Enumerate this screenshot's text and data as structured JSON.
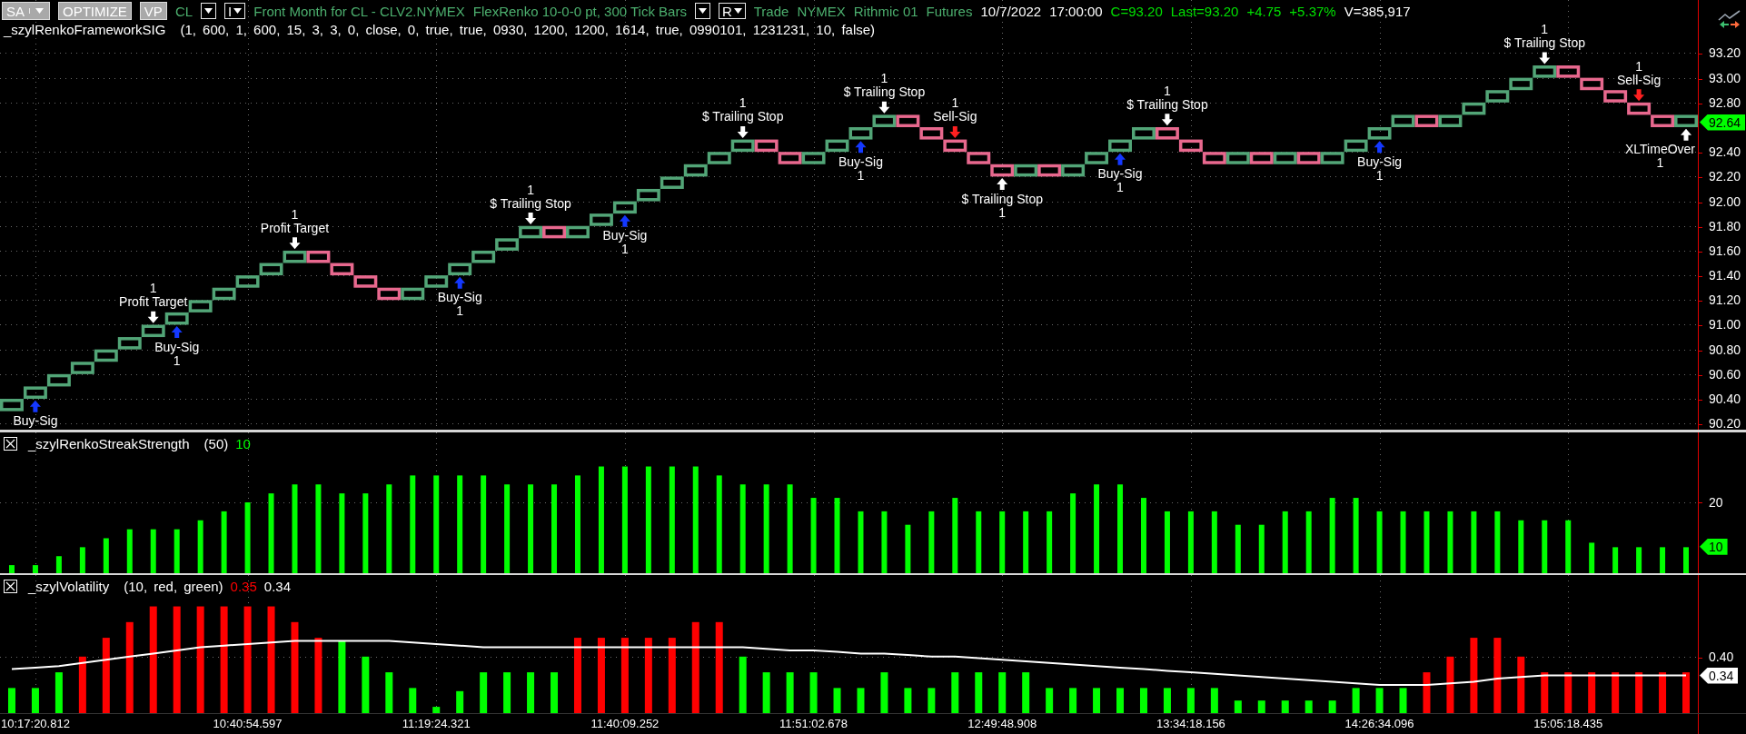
{
  "header": [
    {
      "kind": "button",
      "label": "SA",
      "dropdown": true
    },
    {
      "kind": "button",
      "label": "OPTIMIZE",
      "dropdown": false
    },
    {
      "kind": "button",
      "label": "VP",
      "dropdown": false
    },
    {
      "kind": "text",
      "text": "CL",
      "color": "#4caf6e"
    },
    {
      "kind": "dropdown"
    },
    {
      "kind": "dropdown",
      "label": "I"
    },
    {
      "kind": "text",
      "text": "Front Month for CL - CLV2.NYMEX",
      "color": "#4caf6e"
    },
    {
      "kind": "text",
      "text": "FlexRenko 10-0-0 pt, 300 Tick Bars",
      "color": "#4caf6e"
    },
    {
      "kind": "dropdown"
    },
    {
      "kind": "dropdown",
      "label": "R"
    },
    {
      "kind": "text",
      "text": "Trade",
      "color": "#4caf6e"
    },
    {
      "kind": "text",
      "text": "NYMEX",
      "color": "#4caf6e"
    },
    {
      "kind": "text",
      "text": "Rithmic 01",
      "color": "#4caf6e"
    },
    {
      "kind": "text",
      "text": "Futures",
      "color": "#4caf6e"
    },
    {
      "kind": "text",
      "text": "10/7/2022",
      "color": "#ffffff"
    },
    {
      "kind": "text",
      "text": "17:00:00",
      "color": "#ffffff"
    },
    {
      "kind": "text",
      "text": "C=93.20",
      "color": "#00e000"
    },
    {
      "kind": "text",
      "text": "Last=93.20",
      "color": "#00e000"
    },
    {
      "kind": "text",
      "text": "+4.75",
      "color": "#00e000"
    },
    {
      "kind": "text",
      "text": "+5.37%",
      "color": "#00e000"
    },
    {
      "kind": "text",
      "text": "V=385,917",
      "color": "#ffffff"
    }
  ],
  "panels": [
    {
      "kind": "price",
      "title": "_szylRenkoFrameworkSIG",
      "params": "(1, 600, 1, 600, 15, 3, 3, 0, close, 0, true, true, 0930, 1200, 1200, 1614, true, 0990101, 1231231, 10, false)",
      "marker": {
        "text": "92.64",
        "color": "#00ff00"
      },
      "chart_data": {
        "type": "scatter",
        "categories": [
          null,
          null,
          null,
          null,
          null,
          null,
          null,
          null,
          null,
          null,
          null,
          null,
          null,
          null,
          null,
          null,
          null,
          null,
          null,
          null,
          null,
          null,
          null,
          null,
          null,
          null,
          null,
          null,
          null,
          null,
          null,
          null,
          null,
          null,
          null,
          null,
          null,
          null,
          null,
          null,
          null,
          null,
          null,
          null,
          null,
          null,
          null,
          null,
          null,
          null,
          null,
          null,
          null,
          null,
          null,
          null,
          null,
          null,
          null,
          null,
          null,
          null,
          null,
          null,
          null,
          null,
          null,
          null,
          null,
          null,
          null,
          null
        ],
        "grid": true,
        "ylim": [
          90.15,
          93.63
        ],
        "yticks": [
          {
            "value": 93.2,
            "label": "93.20"
          },
          {
            "value": 93.0,
            "label": "93.00"
          },
          {
            "value": 92.8,
            "label": "92.80"
          },
          {
            "value": 92.4,
            "label": "92.40"
          },
          {
            "value": 92.2,
            "label": "92.20"
          },
          {
            "value": 92.0,
            "label": "92.00"
          },
          {
            "value": 91.8,
            "label": "91.80"
          },
          {
            "value": 91.6,
            "label": "91.60"
          },
          {
            "value": 91.4,
            "label": "91.40"
          },
          {
            "value": 91.2,
            "label": "91.20"
          },
          {
            "value": 91.0,
            "label": "91.00"
          },
          {
            "value": 90.8,
            "label": "90.80"
          },
          {
            "value": 90.6,
            "label": "90.60"
          },
          {
            "value": 90.4,
            "label": "90.40"
          },
          {
            "value": 90.2,
            "label": "90.20"
          }
        ],
        "series": [
          {
            "color": "#52a577",
            "values": [
              90.35,
              90.45,
              90.55,
              90.65,
              90.75,
              90.85,
              90.95,
              91.05,
              91.15,
              91.25,
              91.35,
              91.45,
              91.55,
              null,
              null,
              null,
              null,
              91.25,
              91.35,
              91.45,
              91.55,
              91.65,
              91.75,
              null,
              91.75,
              91.85,
              91.95,
              92.05,
              92.15,
              92.25,
              92.35,
              92.45,
              null,
              null,
              92.35,
              92.45,
              92.55,
              92.65,
              null,
              null,
              null,
              null,
              null,
              92.25,
              null,
              92.25,
              92.35,
              92.45,
              92.55,
              null,
              null,
              null,
              92.35,
              null,
              92.35,
              null,
              92.35,
              92.45,
              92.55,
              92.65,
              null,
              92.65,
              92.75,
              92.85,
              92.95,
              93.05,
              null,
              null,
              null,
              null,
              null,
              92.65
            ]
          },
          {
            "color": "#e8688e",
            "values": [
              null,
              null,
              null,
              null,
              null,
              null,
              null,
              null,
              null,
              null,
              null,
              null,
              null,
              91.55,
              91.45,
              91.35,
              91.25,
              null,
              null,
              null,
              null,
              null,
              null,
              91.75,
              null,
              null,
              null,
              null,
              null,
              null,
              null,
              null,
              92.45,
              92.35,
              null,
              null,
              null,
              null,
              92.65,
              92.55,
              92.45,
              92.35,
              92.25,
              null,
              92.25,
              null,
              null,
              null,
              null,
              92.55,
              92.45,
              92.35,
              null,
              92.35,
              null,
              92.35,
              null,
              null,
              null,
              null,
              92.65,
              null,
              null,
              null,
              null,
              null,
              93.05,
              92.95,
              92.85,
              92.75,
              92.65,
              null
            ]
          },
          {
            "color": "#1438ff",
            "type": "scatter",
            "values": [
              null,
              90.34,
              null,
              null,
              null,
              null,
              null,
              90.94,
              null,
              null,
              null,
              null,
              null,
              null,
              null,
              null,
              null,
              null,
              null,
              91.34,
              null,
              null,
              null,
              null,
              null,
              null,
              91.84,
              null,
              null,
              null,
              null,
              null,
              null,
              null,
              null,
              null,
              92.44,
              null,
              null,
              null,
              null,
              null,
              null,
              null,
              null,
              null,
              null,
              92.34,
              null,
              null,
              null,
              null,
              null,
              null,
              null,
              null,
              null,
              null,
              92.44,
              null,
              null,
              null,
              null,
              null,
              null,
              null,
              null,
              null,
              null,
              null,
              null,
              null
            ]
          },
          {
            "color": "#ff2020",
            "type": "scatter",
            "values": [
              null,
              null,
              null,
              null,
              null,
              null,
              null,
              null,
              null,
              null,
              null,
              null,
              null,
              null,
              null,
              null,
              null,
              null,
              null,
              null,
              null,
              null,
              null,
              null,
              null,
              null,
              null,
              null,
              null,
              null,
              null,
              null,
              null,
              null,
              null,
              null,
              null,
              null,
              null,
              null,
              92.56,
              null,
              null,
              null,
              null,
              null,
              null,
              null,
              null,
              null,
              null,
              null,
              null,
              null,
              null,
              null,
              null,
              null,
              null,
              null,
              null,
              null,
              null,
              null,
              null,
              null,
              null,
              null,
              null,
              92.86,
              null,
              null
            ]
          },
          {
            "color": "#ffffff",
            "type": "scatter",
            "values": [
              null,
              null,
              null,
              null,
              null,
              null,
              91.06,
              null,
              null,
              null,
              null,
              null,
              91.66,
              null,
              null,
              null,
              null,
              null,
              null,
              null,
              null,
              null,
              91.86,
              null,
              null,
              null,
              null,
              null,
              null,
              null,
              null,
              92.56,
              null,
              null,
              null,
              null,
              null,
              92.76,
              null,
              null,
              null,
              null,
              92.14,
              null,
              null,
              null,
              null,
              null,
              null,
              92.66,
              null,
              null,
              null,
              null,
              null,
              null,
              null,
              null,
              null,
              null,
              null,
              null,
              null,
              null,
              null,
              93.16,
              null,
              null,
              null,
              null,
              null,
              92.54
            ]
          }
        ],
        "annotations": [
          "Buy-Sig",
          "1\nProfit Target",
          "Buy-Sig\n1",
          "1\nProfit Target",
          "Buy-Sig\n1",
          "1\n$ Trailing Stop",
          "Buy-Sig\n1",
          "1\n$ Trailing Stop",
          "Buy-Sig\n1",
          "1\n$ Trailing Stop",
          "1\nSell-Sig",
          "$ Trailing Stop\n1",
          "Buy-Sig\n1",
          "1\n$ Trailing Stop",
          "Buy-Sig\n1",
          "1\n$ Trailing Stop",
          "1\nSell-Sig",
          "XLTimeOver\n1"
        ]
      }
    },
    {
      "kind": "histogram",
      "title": "_szylRenkoStreakStrength",
      "params": "(50)",
      "readings": [
        {
          "text": "10",
          "color": "#00ff00"
        }
      ],
      "marker": {
        "color": "#00ff00"
      },
      "chart_data": {
        "type": "bar",
        "categories": [
          null,
          null,
          null,
          null,
          null,
          null,
          null,
          null,
          null,
          null,
          null,
          null,
          null,
          null,
          null,
          null,
          null,
          null,
          null,
          null,
          null,
          null,
          null,
          null,
          null,
          null,
          null,
          null,
          null,
          null,
          null,
          null,
          null,
          null,
          null,
          null,
          null,
          null,
          null,
          null,
          null,
          null,
          null,
          null,
          null,
          null,
          null,
          null,
          null,
          null,
          null,
          null,
          null,
          null,
          null,
          null,
          null,
          null,
          null,
          null,
          null,
          null,
          null,
          null,
          null,
          null,
          null,
          null,
          null,
          null,
          null,
          null
        ],
        "grid": true,
        "ylim": [
          4.2,
          35.6
        ],
        "yticks": [
          {
            "value": 20,
            "label": "20"
          },
          {
            "value": 10,
            "label": "10"
          }
        ],
        "series": [
          {
            "color": "#00ff00",
            "values": [
              6,
              6,
              8,
              10,
              12,
              14,
              14,
              14,
              16,
              18,
              20,
              22,
              24,
              24,
              22,
              22,
              24,
              26,
              26,
              26,
              26,
              24,
              24,
              24,
              26,
              28,
              28,
              28,
              28,
              28,
              26,
              24,
              24,
              24,
              21,
              21,
              18,
              18,
              15,
              18,
              21,
              18,
              18,
              18,
              18,
              22,
              24,
              24,
              21,
              18,
              18,
              18,
              15,
              15,
              18,
              18,
              21,
              21,
              18,
              18,
              18,
              18,
              18,
              18,
              16,
              16,
              16,
              11,
              10,
              10,
              10,
              10
            ]
          }
        ]
      }
    },
    {
      "kind": "histogram",
      "title": "_szylVolatility",
      "params": "(10, red, green)",
      "readings": [
        {
          "text": "0.35",
          "color": "#ff0000"
        },
        {
          "text": "0.34",
          "color": "#ffffff"
        }
      ],
      "marker": {
        "color": "#ffffff"
      },
      "chart_data": {
        "type": "bar",
        "categories": [
          null,
          "10:17:20.812",
          null,
          null,
          null,
          null,
          null,
          null,
          null,
          null,
          "10:40:54.597",
          null,
          null,
          null,
          null,
          null,
          null,
          null,
          "11:19:24.321",
          null,
          null,
          null,
          null,
          null,
          null,
          null,
          "11:40:09.252",
          null,
          null,
          null,
          null,
          null,
          null,
          null,
          "11:51:02.678",
          null,
          null,
          null,
          null,
          null,
          null,
          null,
          "12:49:48.908",
          null,
          null,
          null,
          null,
          null,
          null,
          null,
          "13:34:18.156",
          null,
          null,
          null,
          null,
          null,
          null,
          null,
          "14:26:34.096",
          null,
          null,
          null,
          null,
          null,
          null,
          null,
          "15:05:18.435",
          null,
          null,
          null,
          null,
          null
        ],
        "grid": true,
        "ylim": [
          0.22,
          0.66
        ],
        "yticks": [
          {
            "value": 0.4,
            "label": "0.40"
          },
          {
            "value": 0.34,
            "label": "0.34"
          }
        ],
        "series": [
          {
            "color": "#ff0000",
            "values": [
              null,
              null,
              null,
              0.4,
              0.46,
              0.51,
              0.56,
              0.56,
              0.56,
              0.56,
              0.56,
              0.56,
              0.51,
              0.46,
              null,
              null,
              null,
              null,
              null,
              null,
              null,
              null,
              null,
              null,
              0.46,
              0.46,
              0.46,
              0.46,
              0.46,
              0.51,
              0.51,
              null,
              null,
              null,
              null,
              null,
              null,
              null,
              null,
              null,
              null,
              null,
              null,
              null,
              null,
              null,
              null,
              null,
              null,
              null,
              null,
              null,
              null,
              null,
              null,
              null,
              null,
              null,
              null,
              null,
              0.35,
              0.4,
              0.46,
              0.46,
              0.4,
              0.35,
              0.35,
              0.35,
              0.35,
              0.35,
              0.35,
              0.35
            ]
          },
          {
            "color": "#00ff00",
            "values": [
              0.3,
              0.3,
              0.35,
              null,
              null,
              null,
              null,
              null,
              null,
              null,
              null,
              null,
              null,
              null,
              0.45,
              0.4,
              0.35,
              0.3,
              0.24,
              0.29,
              0.35,
              0.35,
              0.35,
              0.35,
              null,
              null,
              null,
              null,
              null,
              null,
              null,
              0.4,
              0.35,
              0.35,
              0.35,
              0.3,
              0.3,
              0.35,
              0.3,
              0.3,
              0.35,
              0.35,
              0.35,
              0.35,
              0.3,
              0.3,
              0.3,
              0.3,
              0.3,
              0.3,
              0.3,
              0.3,
              0.26,
              0.26,
              0.26,
              0.26,
              0.26,
              0.3,
              0.3,
              0.3,
              null,
              null,
              null,
              null,
              null,
              null,
              null,
              null,
              null,
              null,
              null,
              null
            ]
          },
          {
            "color": "#ffffff",
            "type": "line",
            "values": [
              0.36,
              0.365,
              0.37,
              0.38,
              0.39,
              0.4,
              0.41,
              0.42,
              0.43,
              0.435,
              0.44,
              0.445,
              0.45,
              0.45,
              0.45,
              0.45,
              0.45,
              0.445,
              0.44,
              0.435,
              0.43,
              0.43,
              0.43,
              0.43,
              0.43,
              0.43,
              0.43,
              0.43,
              0.43,
              0.43,
              0.43,
              0.43,
              0.425,
              0.42,
              0.42,
              0.415,
              0.41,
              0.41,
              0.405,
              0.4,
              0.4,
              0.395,
              0.39,
              0.385,
              0.38,
              0.375,
              0.37,
              0.365,
              0.36,
              0.355,
              0.35,
              0.345,
              0.34,
              0.335,
              0.33,
              0.325,
              0.32,
              0.315,
              0.31,
              0.31,
              0.31,
              0.315,
              0.32,
              0.33,
              0.335,
              0.34,
              0.34,
              0.34,
              0.34,
              0.34,
              0.34,
              0.34
            ]
          }
        ]
      }
    }
  ]
}
